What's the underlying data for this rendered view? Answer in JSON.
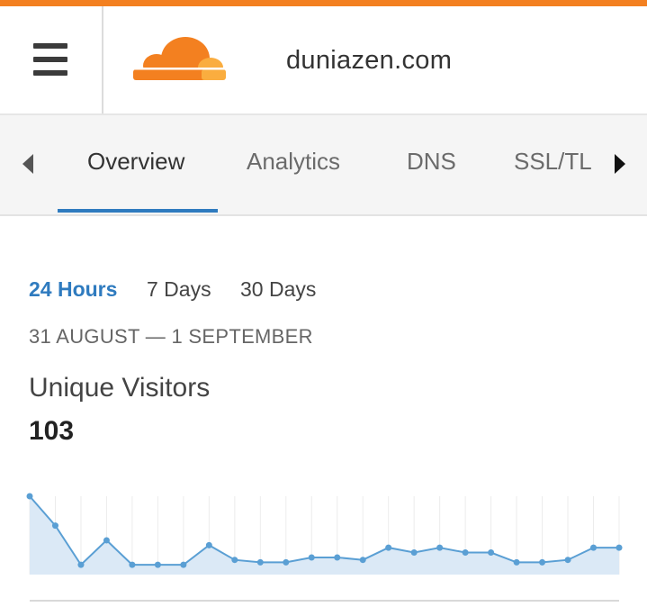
{
  "header": {
    "domain": "duniazen.com",
    "menu_icon": "hamburger-menu-icon",
    "logo": "cloudflare-cloud-logo",
    "accent_color": "#f38020"
  },
  "tabs": {
    "items": [
      {
        "label": "Overview",
        "active": true
      },
      {
        "label": "Analytics",
        "active": false
      },
      {
        "label": "DNS",
        "active": false
      },
      {
        "label": "SSL/TL",
        "active": false
      }
    ],
    "left_icon": "caret-left-icon",
    "right_icon": "caret-right-icon",
    "active_color": "#2f7bbf"
  },
  "time_ranges": [
    {
      "label": "24 Hours",
      "active": true
    },
    {
      "label": "7 Days",
      "active": false
    },
    {
      "label": "30 Days",
      "active": false
    }
  ],
  "date_range": "31 AUGUST — 1 SEPTEMBER",
  "metric": {
    "label": "Unique Visitors",
    "value": "103"
  },
  "chart_data": {
    "type": "area",
    "values": [
      16,
      10,
      2,
      7,
      2,
      2,
      2,
      6,
      3,
      2.5,
      2.5,
      3.5,
      3.5,
      3,
      5.5,
      4.5,
      5.5,
      4.5,
      4.5,
      2.5,
      2.5,
      3,
      5.5,
      5.5
    ],
    "ylim": [
      0,
      16
    ],
    "line_color": "#5a9fd4",
    "fill_color": "#dbe9f6",
    "grid": true
  }
}
